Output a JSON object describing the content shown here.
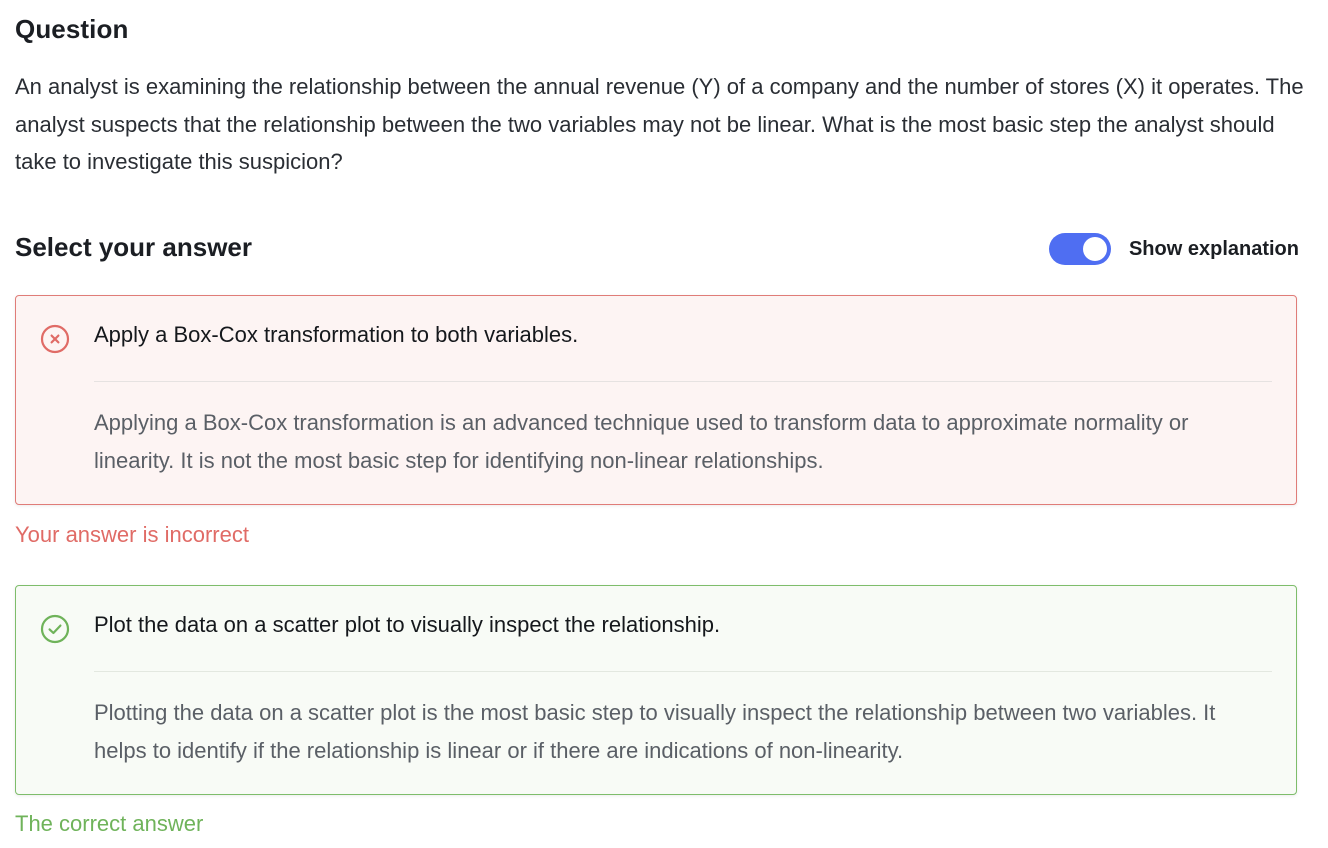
{
  "question": {
    "heading": "Question",
    "text": "An analyst is examining the relationship between the annual revenue (Y) of a company and the number of stores (X) it operates. The analyst suspects that the relationship between the two variables may not be linear. What is the most basic step the analyst should take to investigate this suspicion?"
  },
  "answer_section": {
    "heading": "Select your answer",
    "toggle": {
      "label": "Show explanation",
      "on": true,
      "color": "#4f6ef2"
    }
  },
  "options": [
    {
      "status": "incorrect",
      "icon": "x-circle-icon",
      "title": "Apply a Box-Cox transformation to both variables.",
      "explanation": "Applying a Box-Cox transformation is an advanced technique used to transform data to approximate normality or linearity. It is not the most basic step for identifying non-linear relationships.",
      "verdict": "Your answer is incorrect",
      "color": "#e06b66"
    },
    {
      "status": "correct",
      "icon": "check-circle-icon",
      "title": "Plot the data on a scatter plot to visually inspect the relationship.",
      "explanation": "Plotting the data on a scatter plot is the most basic step to visually inspect the relationship between two variables. It helps to identify if the relationship is linear or if there are indications of non-linearity.",
      "verdict": "The correct answer",
      "color": "#6fb35a"
    }
  ]
}
